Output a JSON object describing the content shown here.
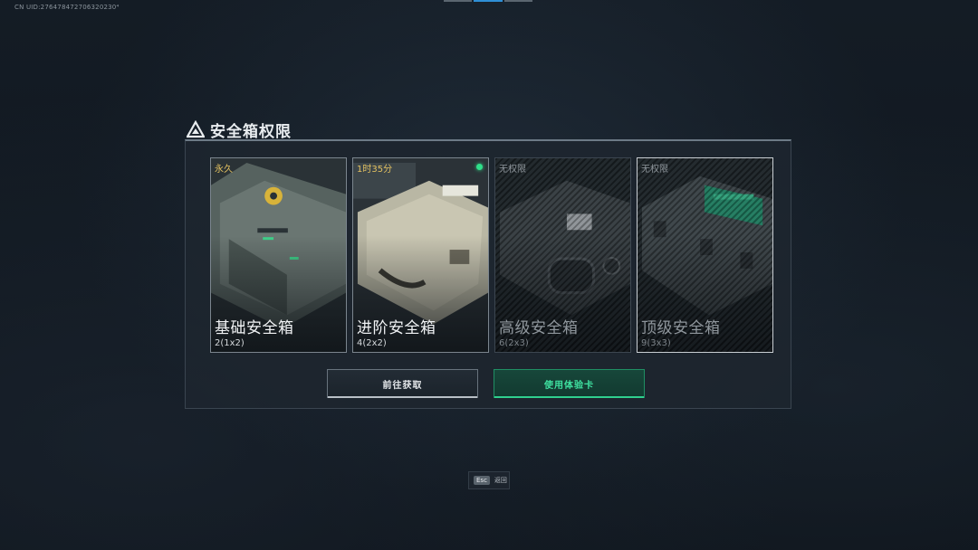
{
  "header": {
    "uid": "CN UID:2764784727063202305⁴",
    "uid_text": "CN UID:276478472706320230⁴"
  },
  "dialog": {
    "title": "安全箱权限",
    "title_icon": "warning-triangle-icon"
  },
  "cards": [
    {
      "tag": "永久",
      "name": "基础安全箱",
      "size": "2(1x2)",
      "locked": false,
      "selected": false,
      "art": "case-green-icon"
    },
    {
      "tag": "1时35分",
      "name": "进阶安全箱",
      "size": "4(2x2)",
      "locked": false,
      "selected": false,
      "active_indicator": true,
      "art": "case-beige-icon"
    },
    {
      "tag": "无权限",
      "name": "高级安全箱",
      "size": "6(2x3)",
      "locked": true,
      "selected": false,
      "art": "case-dark-icon"
    },
    {
      "tag": "无权限",
      "name": "顶级安全箱",
      "size": "9(3x3)",
      "locked": true,
      "selected": true,
      "art": "case-teal-icon"
    }
  ],
  "buttons": {
    "get": "前往获取",
    "use": "使用体验卡"
  },
  "footer": {
    "esc_key": "Esc",
    "esc_label": "返回"
  },
  "colors": {
    "accent_green": "#2fe08a",
    "timer_gold": "#e2c060",
    "panel_bg": "#1e262f"
  }
}
